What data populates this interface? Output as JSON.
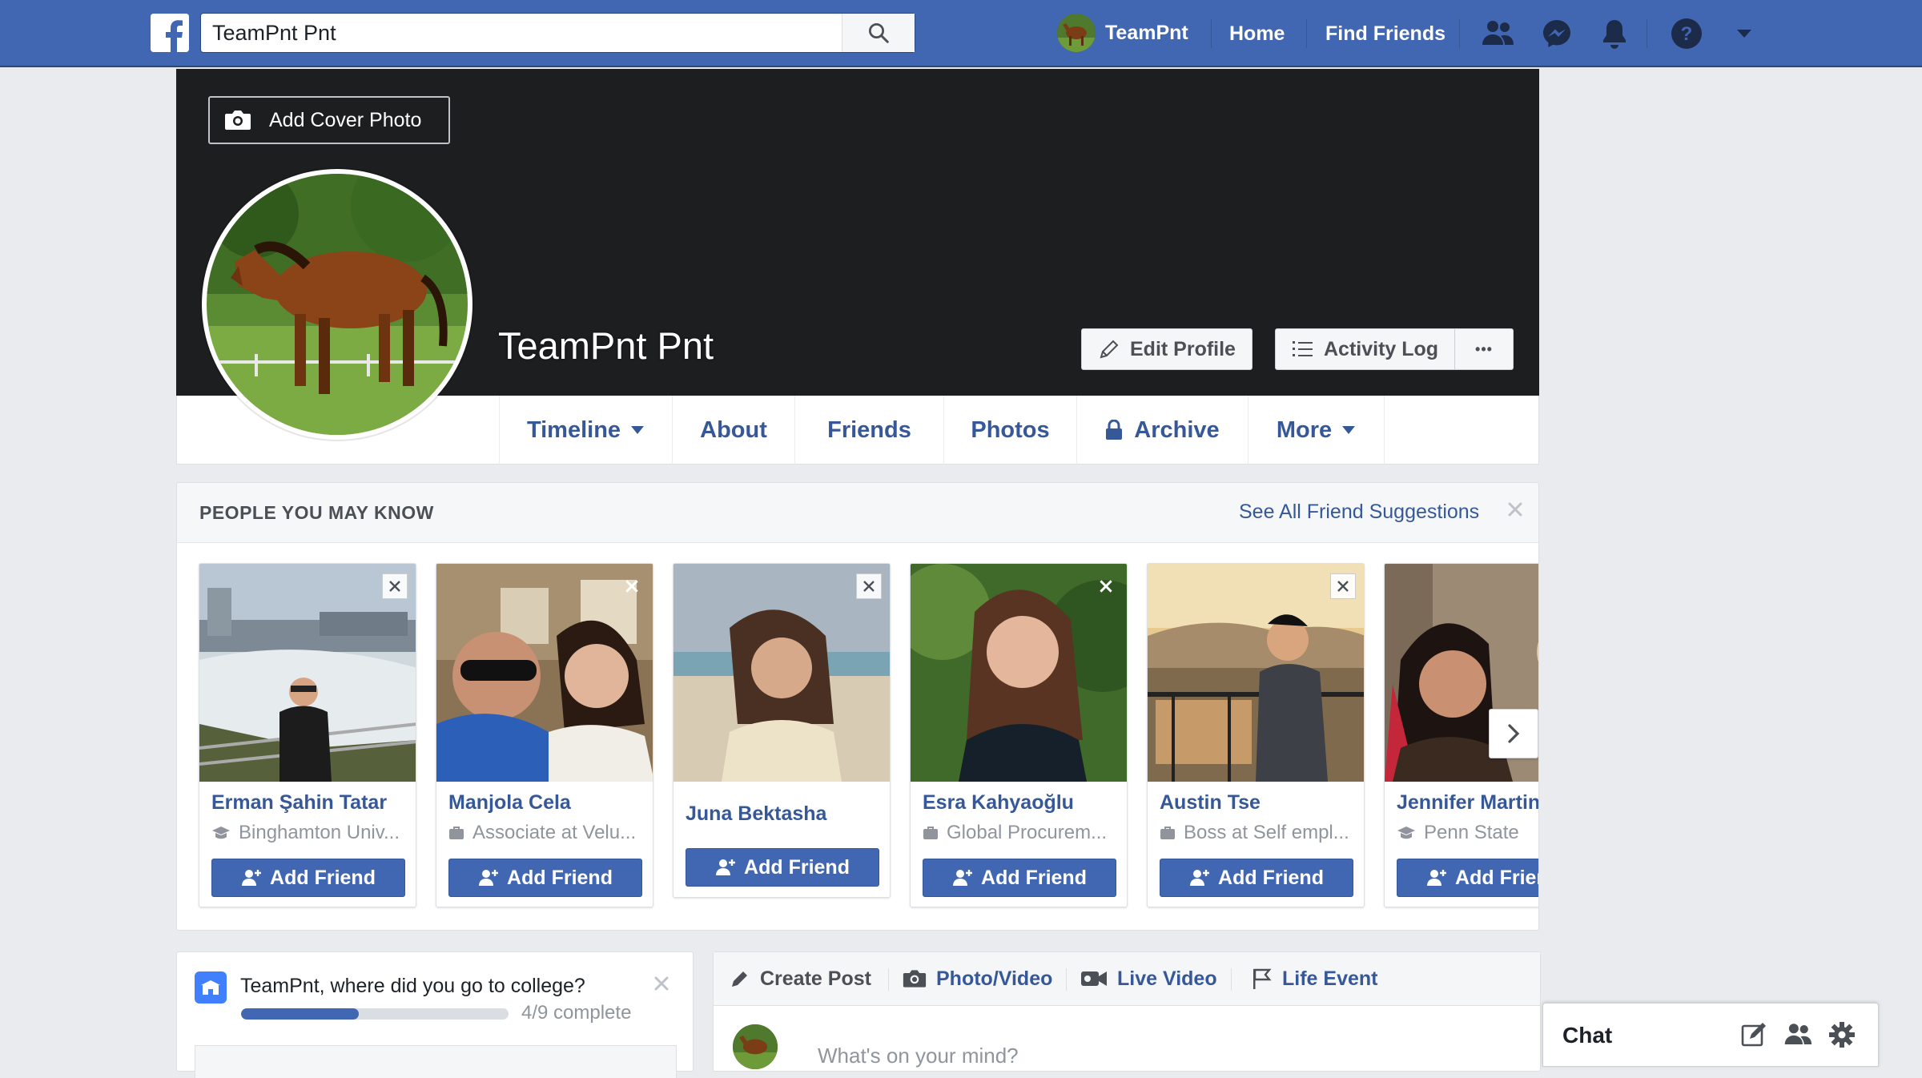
{
  "topbar": {
    "search_value": "TeamPnt Pnt",
    "user_name": "TeamPnt",
    "home": "Home",
    "find_friends": "Find Friends"
  },
  "cover": {
    "add_cover_label": "Add Cover Photo",
    "profile_name": "TeamPnt Pnt",
    "edit_profile": "Edit Profile",
    "activity_log": "Activity Log",
    "more_dots": "•••"
  },
  "tabs": {
    "timeline": "Timeline",
    "about": "About",
    "friends": "Friends",
    "photos": "Photos",
    "archive": "Archive",
    "more": "More"
  },
  "pymk": {
    "title": "PEOPLE YOU MAY KNOW",
    "see_all": "See All Friend Suggestions",
    "add_friend_label": "Add Friend",
    "people": [
      {
        "name": "Erman Şahin Tatar",
        "detail": "Binghamton Univ...",
        "detail_icon": "school-icon"
      },
      {
        "name": "Manjola Cela",
        "detail": "Associate at Velu...",
        "detail_icon": "work-icon"
      },
      {
        "name": "Juna Bektasha",
        "detail": "",
        "detail_icon": ""
      },
      {
        "name": "Esra Kahyaoğlu",
        "detail": "Global Procurem...",
        "detail_icon": "work-icon"
      },
      {
        "name": "Austin Tse",
        "detail": "Boss at Self empl...",
        "detail_icon": "work-icon"
      },
      {
        "name": "Jennifer Martin",
        "detail": "Penn State",
        "detail_icon": "school-icon"
      }
    ]
  },
  "college": {
    "question": "TeamPnt, where did you go to college?",
    "progress_text": "4/9 complete",
    "progress_fraction": 0.44
  },
  "create_post": {
    "create": "Create Post",
    "photo_video": "Photo/Video",
    "live_video": "Live Video",
    "life_event": "Life Event",
    "placeholder": "What's on your mind?"
  },
  "chat": {
    "label": "Chat"
  },
  "colors": {
    "brand_blue": "#4267b2",
    "link_blue": "#365899",
    "cover_dark": "#1d1e20",
    "page_bg": "#e9ebee"
  }
}
